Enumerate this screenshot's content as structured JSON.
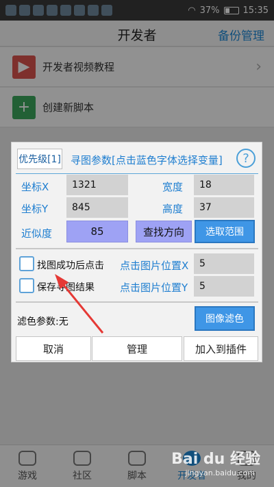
{
  "status_bar": {
    "battery": "37%",
    "time": "15:35"
  },
  "app": {
    "title": "开发者",
    "backup_label": "备份管理"
  },
  "menu": [
    {
      "label": "开发者视频教程",
      "icon": "play-icon",
      "color": "#d9534f"
    },
    {
      "label": "创建新脚本",
      "icon": "plus-icon",
      "color": "#3ba55c"
    }
  ],
  "dialog": {
    "priority_label": "优先级[1]",
    "title": "寻图参数[点击蓝色字体选择变量]",
    "x_label": "坐标X",
    "x_value": "1321",
    "y_label": "坐标Y",
    "y_value": "845",
    "width_label": "宽度",
    "width_value": "18",
    "height_label": "高度",
    "height_value": "37",
    "similarity_label": "近似度",
    "similarity_value": "85",
    "find_direction_label": "查找方向",
    "select_range_label": "选取范围",
    "click_after_found_label": "找图成功后点击",
    "save_result_label": "保存寻图结果",
    "click_pos_x_label": "点击图片位置X",
    "click_pos_x_value": "5",
    "click_pos_y_label": "点击图片位置Y",
    "click_pos_y_value": "5",
    "filter_label": "滤色参数:无",
    "image_filter_label": "图像滤色",
    "cancel_label": "取消",
    "manage_label": "管理",
    "add_to_plugin_label": "加入到插件"
  },
  "bottom_nav": [
    {
      "label": "游戏",
      "icon": "gamepad-icon"
    },
    {
      "label": "社区",
      "icon": "community-icon"
    },
    {
      "label": "脚本",
      "icon": "script-icon"
    },
    {
      "label": "开发者",
      "icon": "star-icon",
      "active": true
    },
    {
      "label": "我的",
      "icon": "profile-icon"
    }
  ],
  "colors": {
    "accent": "#1e88d6",
    "button_blue": "#3f96e6",
    "purple": "#9ea2f4",
    "arrow_red": "#e53935"
  },
  "watermark": {
    "brand": "Bai du 经验",
    "url": "jingyan.baidu.com"
  }
}
